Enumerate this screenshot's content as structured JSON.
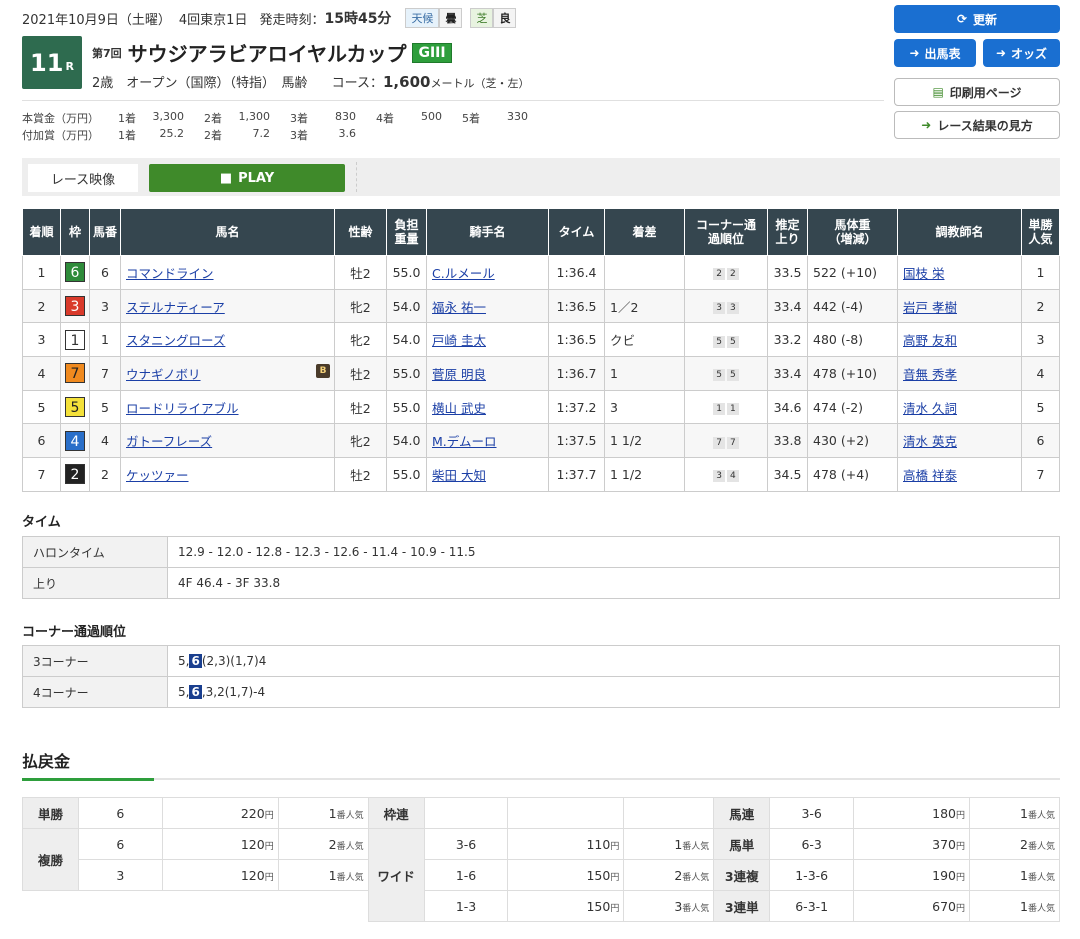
{
  "header": {
    "date": "2021年10月9日（土曜）",
    "meeting": "4回東京1日",
    "post_label": "発走時刻：",
    "post_time": "15時45分",
    "weather_label": "天候",
    "weather": "曇",
    "going_label": "芝",
    "going": "良"
  },
  "race": {
    "number": "11",
    "r": "R",
    "kai": "第7回",
    "name": "サウジアラビアロイヤルカップ",
    "grade": "GIII",
    "conditions": "2歳　オープン（国際）（特指）　馬齢",
    "course_label": "コース：",
    "distance": "1,600",
    "course_detail": "メートル（芝・左）"
  },
  "prize": {
    "main_label": "本賞金（万円）",
    "main": [
      [
        "1着",
        "3,300"
      ],
      [
        "2着",
        "1,300"
      ],
      [
        "3着",
        "830"
      ],
      [
        "4着",
        "500"
      ],
      [
        "5着",
        "330"
      ]
    ],
    "add_label": "付加賞（万円）",
    "add": [
      [
        "1着",
        "25.2"
      ],
      [
        "2着",
        "7.2"
      ],
      [
        "3着",
        "3.6"
      ]
    ]
  },
  "buttons": {
    "refresh": "更新",
    "entries": "出馬表",
    "odds": "オッズ",
    "print": "印刷用ページ",
    "howto": "レース結果の見方"
  },
  "video": {
    "label": "レース映像",
    "play": "PLAY"
  },
  "results": {
    "headers": [
      "着順",
      "枠",
      "馬番",
      "馬名",
      "性齢",
      "負担重量",
      "騎手名",
      "タイム",
      "着差",
      "コーナー通過順位",
      "推定上り",
      "馬体重（増減）",
      "調教師名",
      "単勝人気"
    ],
    "rows": [
      {
        "place": "1",
        "waku": "6",
        "umaban": "6",
        "horse": "コマンドライン",
        "blinker": "",
        "sexage": "牡2",
        "weight": "55.0",
        "jockey": "C.ルメール",
        "time": "1:36.4",
        "margin": "",
        "c1": "2",
        "c2": "2",
        "last3f": "33.5",
        "bw": "522",
        "bwd": "(+10)",
        "trainer": "国枝 栄",
        "pop": "1"
      },
      {
        "place": "2",
        "waku": "3",
        "umaban": "3",
        "horse": "ステルナティーア",
        "blinker": "",
        "sexage": "牝2",
        "weight": "54.0",
        "jockey": "福永 祐一",
        "time": "1:36.5",
        "margin": "1／2",
        "c1": "3",
        "c2": "3",
        "last3f": "33.4",
        "bw": "442",
        "bwd": "(-4)",
        "trainer": "岩戸 孝樹",
        "pop": "2"
      },
      {
        "place": "3",
        "waku": "1",
        "umaban": "1",
        "horse": "スタニングローズ",
        "blinker": "",
        "sexage": "牝2",
        "weight": "54.0",
        "jockey": "戸崎 圭太",
        "time": "1:36.5",
        "margin": "クビ",
        "c1": "5",
        "c2": "5",
        "last3f": "33.2",
        "bw": "480",
        "bwd": "(-8)",
        "trainer": "高野 友和",
        "pop": "3"
      },
      {
        "place": "4",
        "waku": "7",
        "umaban": "7",
        "horse": "ウナギノボリ",
        "blinker": "B",
        "sexage": "牡2",
        "weight": "55.0",
        "jockey": "菅原 明良",
        "time": "1:36.7",
        "margin": "1",
        "c1": "5",
        "c2": "5",
        "last3f": "33.4",
        "bw": "478",
        "bwd": "(+10)",
        "trainer": "音無 秀孝",
        "pop": "4"
      },
      {
        "place": "5",
        "waku": "5",
        "umaban": "5",
        "horse": "ロードリライアブル",
        "blinker": "",
        "sexage": "牡2",
        "weight": "55.0",
        "jockey": "横山 武史",
        "time": "1:37.2",
        "margin": "3",
        "c1": "1",
        "c2": "1",
        "last3f": "34.6",
        "bw": "474",
        "bwd": "(-2)",
        "trainer": "清水 久詞",
        "pop": "5"
      },
      {
        "place": "6",
        "waku": "4",
        "umaban": "4",
        "horse": "ガトーフレーズ",
        "blinker": "",
        "sexage": "牝2",
        "weight": "54.0",
        "jockey": "M.デムーロ",
        "time": "1:37.5",
        "margin": "1 1/2",
        "c1": "7",
        "c2": "7",
        "last3f": "33.8",
        "bw": "430",
        "bwd": "(+2)",
        "trainer": "清水 英克",
        "pop": "6"
      },
      {
        "place": "7",
        "waku": "2",
        "umaban": "2",
        "horse": "ケッツァー",
        "blinker": "",
        "sexage": "牡2",
        "weight": "55.0",
        "jockey": "柴田 大知",
        "time": "1:37.7",
        "margin": "1 1/2",
        "c1": "3",
        "c2": "4",
        "last3f": "34.5",
        "bw": "478",
        "bwd": "(+4)",
        "trainer": "高橋 祥泰",
        "pop": "7"
      }
    ]
  },
  "waku_colors": {
    "1": [
      "#ffffff",
      "#333333"
    ],
    "2": [
      "#222222",
      "#ffffff"
    ],
    "3": [
      "#d93a2b",
      "#ffffff"
    ],
    "4": [
      "#2a6fc9",
      "#ffffff"
    ],
    "5": [
      "#f4e13a",
      "#222222"
    ],
    "6": [
      "#2e8b3a",
      "#ffffff"
    ],
    "7": [
      "#f08a1f",
      "#222222"
    ]
  },
  "time": {
    "heading": "タイム",
    "furlong_label": "ハロンタイム",
    "furlong": "12.9 - 12.0 - 12.8 - 12.3 - 12.6 - 11.4 - 10.9 - 11.5",
    "last_label": "上り",
    "last": "4F 46.4 - 3F 33.8"
  },
  "corner": {
    "heading": "コーナー通過順位",
    "c3_label": "3コーナー",
    "c3_pre": "5,",
    "c3_hl": "6",
    "c3_post": "(2,3)(1,7)4",
    "c4_label": "4コーナー",
    "c4_pre": "5,",
    "c4_hl": "6",
    "c4_post": ",3,2(1,7)-4"
  },
  "payout": {
    "heading": "払戻金",
    "yen": "円",
    "ninki": "番人気",
    "tansho": {
      "label": "単勝",
      "num": "6",
      "amount": "220",
      "pop": "1"
    },
    "fukusho": {
      "label": "複勝",
      "rows": [
        [
          "6",
          "120",
          "2"
        ],
        [
          "3",
          "120",
          "1"
        ]
      ]
    },
    "wakuren": {
      "label": "枠連"
    },
    "wide": {
      "label": "ワイド",
      "rows": [
        [
          "3-6",
          "110",
          "1"
        ],
        [
          "1-6",
          "150",
          "2"
        ],
        [
          "1-3",
          "150",
          "3"
        ]
      ]
    },
    "umaren": {
      "label": "馬連",
      "num": "3-6",
      "amount": "180",
      "pop": "1"
    },
    "umatan": {
      "label": "馬単",
      "num": "6-3",
      "amount": "370",
      "pop": "2"
    },
    "sanrenpuku": {
      "label": "3連複",
      "num": "1-3-6",
      "amount": "190",
      "pop": "1"
    },
    "sanrentan": {
      "label": "3連単",
      "num": "6-3-1",
      "amount": "670",
      "pop": "1"
    }
  }
}
